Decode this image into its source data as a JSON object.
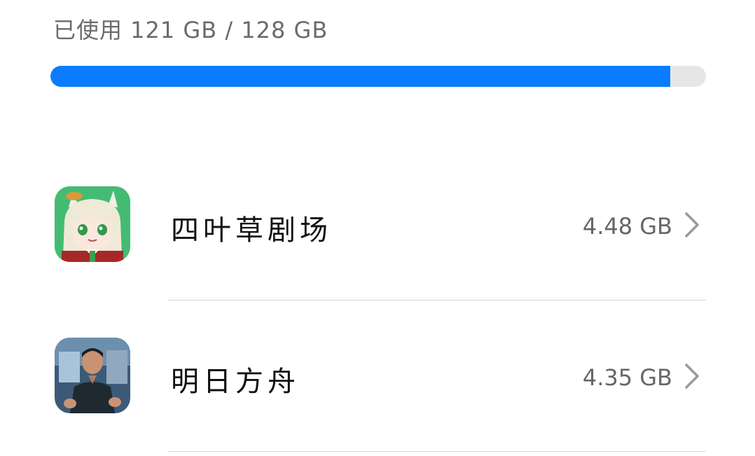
{
  "storage": {
    "usage_text": "已使用 121 GB / 128 GB",
    "used_gb": 121,
    "total_gb": 128,
    "fill_fraction": 0.945
  },
  "apps": [
    {
      "name": "四叶草剧场",
      "size": "4.48 GB",
      "icon": "anime-character-app-icon"
    },
    {
      "name": "明日方舟",
      "size": "4.35 GB",
      "icon": "person-photo-app-icon"
    }
  ],
  "colors": {
    "accent": "#0a7cff",
    "track": "#e6e6e6",
    "divider": "#d6d6d6"
  }
}
